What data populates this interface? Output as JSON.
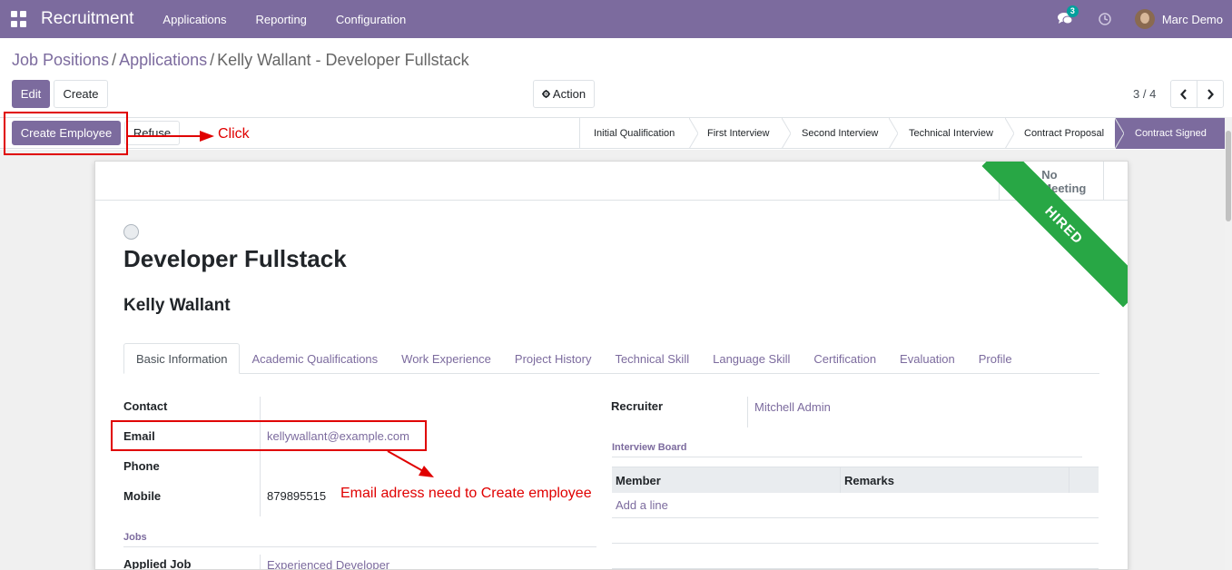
{
  "navbar": {
    "app_title": "Recruitment",
    "menu": [
      "Applications",
      "Reporting",
      "Configuration"
    ],
    "chat_count": "3",
    "user_name": "Marc Demo",
    "color": "#7c6b9e"
  },
  "breadcrumb": {
    "items": [
      "Job Positions",
      "Applications"
    ],
    "separator": "/",
    "current": "Kelly Wallant - Developer Fullstack"
  },
  "control": {
    "edit_label": "Edit",
    "create_label": "Create",
    "action_label": "Action",
    "pager": "3 / 4"
  },
  "statusbar": {
    "create_employee_label": "Create Employee",
    "refuse_label": "Refuse",
    "stages": [
      "Initial Qualification",
      "First Interview",
      "Second Interview",
      "Technical Interview",
      "Contract Proposal",
      "Contract Signed"
    ],
    "active_stage": "Contract Signed"
  },
  "sheet": {
    "meeting_label": "No Meeting",
    "ribbon": "HIRED",
    "job_title": "Developer Fullstack",
    "candidate_name": "Kelly Wallant",
    "tabs": [
      "Basic Information",
      "Academic Qualifications",
      "Work Experience",
      "Project History",
      "Technical Skill",
      "Language Skill",
      "Certification",
      "Evaluation",
      "Profile"
    ],
    "active_tab": "Basic Information",
    "fields": {
      "contact_label": "Contact",
      "email_label": "Email",
      "email_value": "kellywallant@example.com",
      "phone_label": "Phone",
      "mobile_label": "Mobile",
      "mobile_value": "879895515",
      "jobs_group": "Jobs",
      "applied_job_label": "Applied Job",
      "applied_job_value": "Experienced Developer",
      "recruiter_label": "Recruiter",
      "recruiter_value": "Mitchell Admin"
    },
    "interview_board": {
      "title": "Interview Board",
      "columns": [
        "Member",
        "Remarks"
      ],
      "add_line": "Add a line"
    }
  },
  "annotations": {
    "click_text": "Click",
    "email_note": "Email adress need to Create employee",
    "color": "#e00000"
  }
}
